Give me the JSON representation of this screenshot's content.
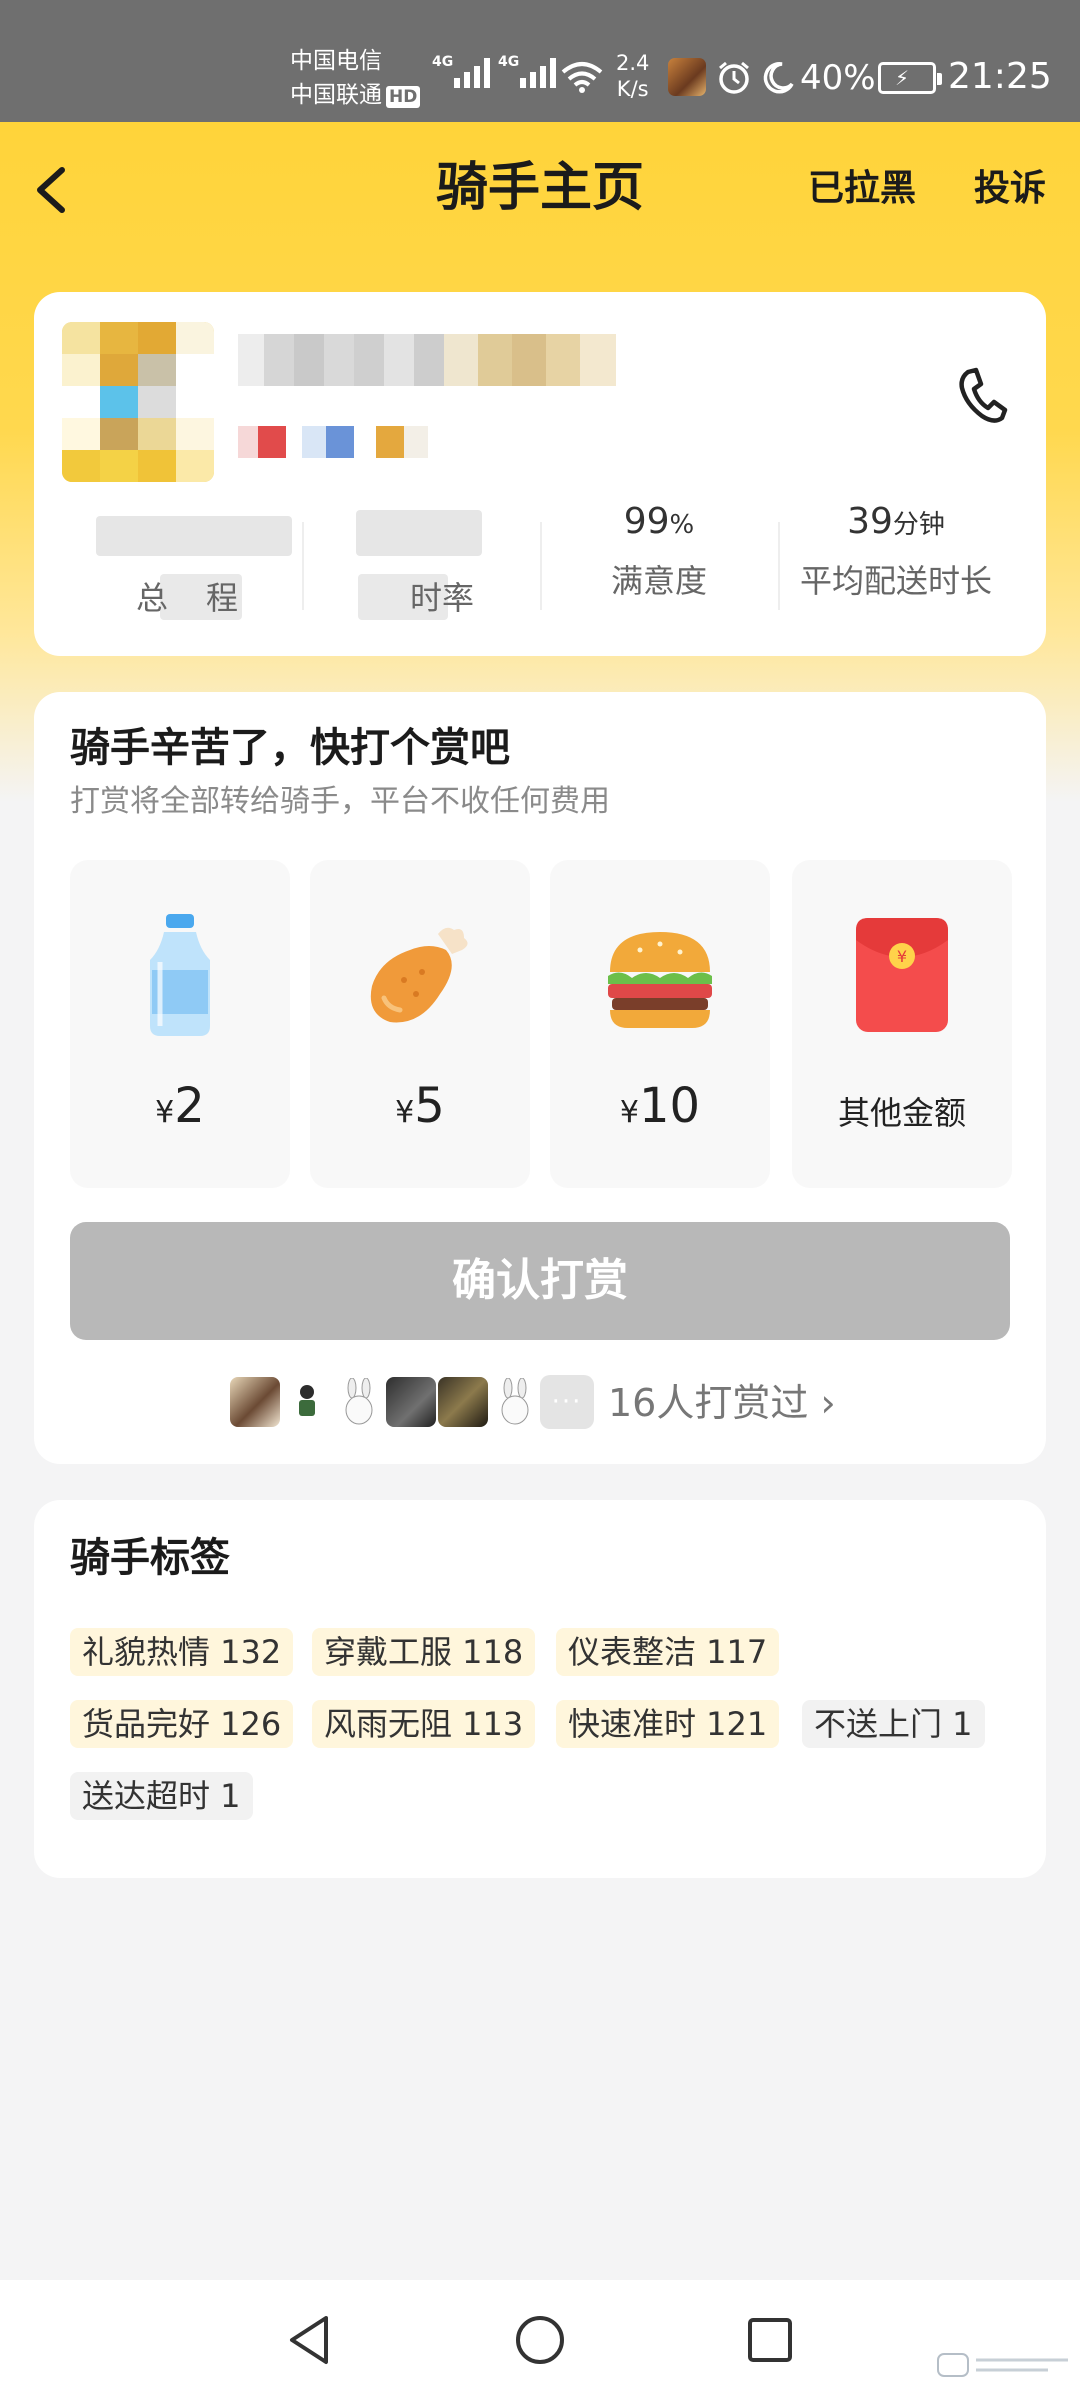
{
  "status_bar": {
    "carrier_1": "中国电信",
    "carrier_2": "中国联通",
    "hd_badge": "HD",
    "net_1": "4G",
    "net_2": "4G",
    "speed_value": "2.4",
    "speed_unit": "K/s",
    "battery": "40%",
    "time": "21:25"
  },
  "nav": {
    "title": "骑手主页",
    "blocked_label": "已拉黑",
    "complain_label": "投诉"
  },
  "rider": {
    "stats": [
      {
        "value": "99",
        "unit": "%",
        "label": "满意度"
      },
      {
        "value": "39",
        "unit": "分钟",
        "label": "平均配送时长"
      }
    ],
    "partial_labels": [
      "总",
      "程",
      "时率"
    ]
  },
  "tip": {
    "title": "骑手辛苦了，快打个赏吧",
    "subtitle": "打赏将全部转给骑手，平台不收任何费用",
    "options": [
      {
        "icon": "water-bottle-icon",
        "currency": "¥",
        "amount": "2"
      },
      {
        "icon": "chicken-leg-icon",
        "currency": "¥",
        "amount": "5"
      },
      {
        "icon": "burger-icon",
        "currency": "¥",
        "amount": "10"
      },
      {
        "icon": "red-envelope-icon",
        "label": "其他金额",
        "envelope_char": "¥"
      }
    ],
    "confirm_label": "确认打赏",
    "more_dots": "···",
    "tippers_text": "16人打赏过",
    "tippers_arrow": "›"
  },
  "tags": {
    "title": "骑手标签",
    "items": [
      {
        "text": "礼貌热情 132",
        "type": "positive"
      },
      {
        "text": "穿戴工服 118",
        "type": "positive"
      },
      {
        "text": "仪表整洁 117",
        "type": "positive"
      },
      {
        "text": "货品完好 126",
        "type": "positive"
      },
      {
        "text": "风雨无阻 113",
        "type": "positive"
      },
      {
        "text": "快速准时 121",
        "type": "positive"
      },
      {
        "text": "不送上门 1",
        "type": "negative"
      },
      {
        "text": "送达超时 1",
        "type": "negative"
      }
    ]
  },
  "colors": {
    "header_yellow": "#ffd43a",
    "confirm_disabled": "#b8b8b8",
    "tag_positive_bg": "#fff6dc",
    "tag_negative_bg": "#f2f2f2"
  }
}
